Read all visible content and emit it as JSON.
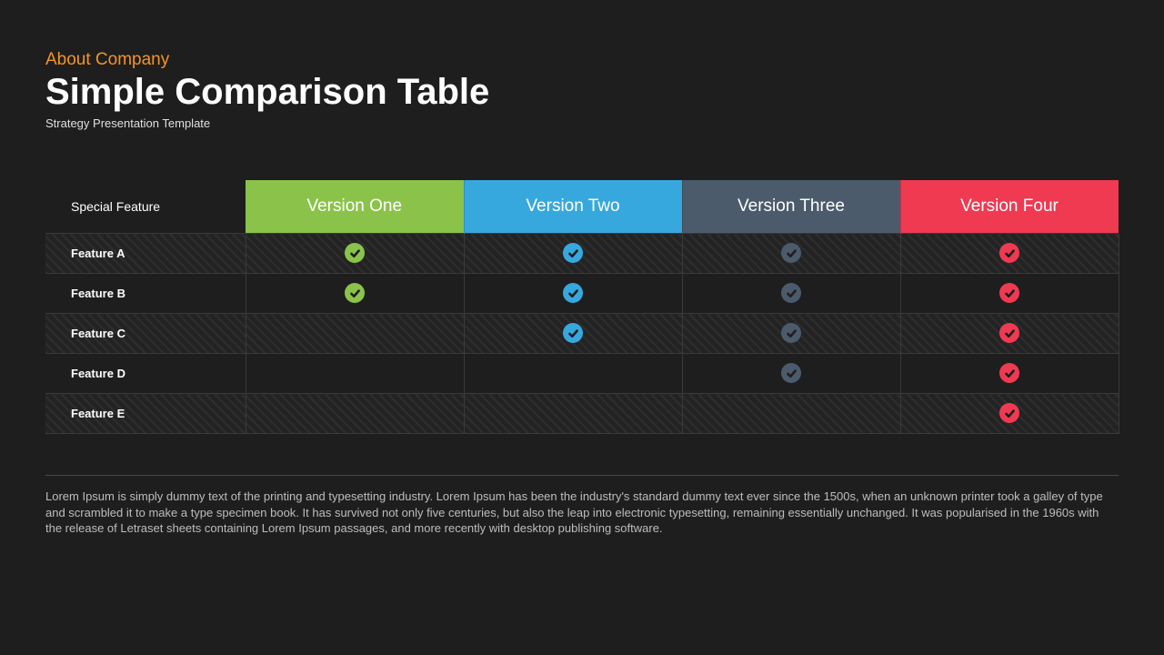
{
  "header": {
    "pretitle": "About Company",
    "title": "Simple Comparison Table",
    "subtitle": "Strategy Presentation Template"
  },
  "table": {
    "feature_header": "Special Feature",
    "columns": [
      "Version One",
      "Version Two",
      "Version Three",
      "Version Four"
    ],
    "rows": [
      {
        "label": "Feature A",
        "values": [
          true,
          true,
          true,
          true
        ]
      },
      {
        "label": "Feature B",
        "values": [
          true,
          true,
          true,
          true
        ]
      },
      {
        "label": "Feature C",
        "values": [
          false,
          true,
          true,
          true
        ]
      },
      {
        "label": "Feature D",
        "values": [
          false,
          false,
          true,
          true
        ]
      },
      {
        "label": "Feature E",
        "values": [
          false,
          false,
          false,
          true
        ]
      }
    ]
  },
  "footer": {
    "paragraph": "Lorem Ipsum is simply dummy text of the printing and typesetting industry. Lorem Ipsum has been the industry's standard dummy text ever since the 1500s, when an unknown printer took a galley of type and scrambled it to make a type specimen book. It has survived not only five centuries, but also the leap into electronic typesetting, remaining essentially unchanged. It was popularised in the 1960s with the release of Letraset sheets containing Lorem Ipsum passages, and more recently with desktop publishing software."
  },
  "colors": {
    "v1": "#8bc34a",
    "v2": "#37a8dd",
    "v3": "#4c5b6b",
    "v4": "#ef3a52"
  }
}
